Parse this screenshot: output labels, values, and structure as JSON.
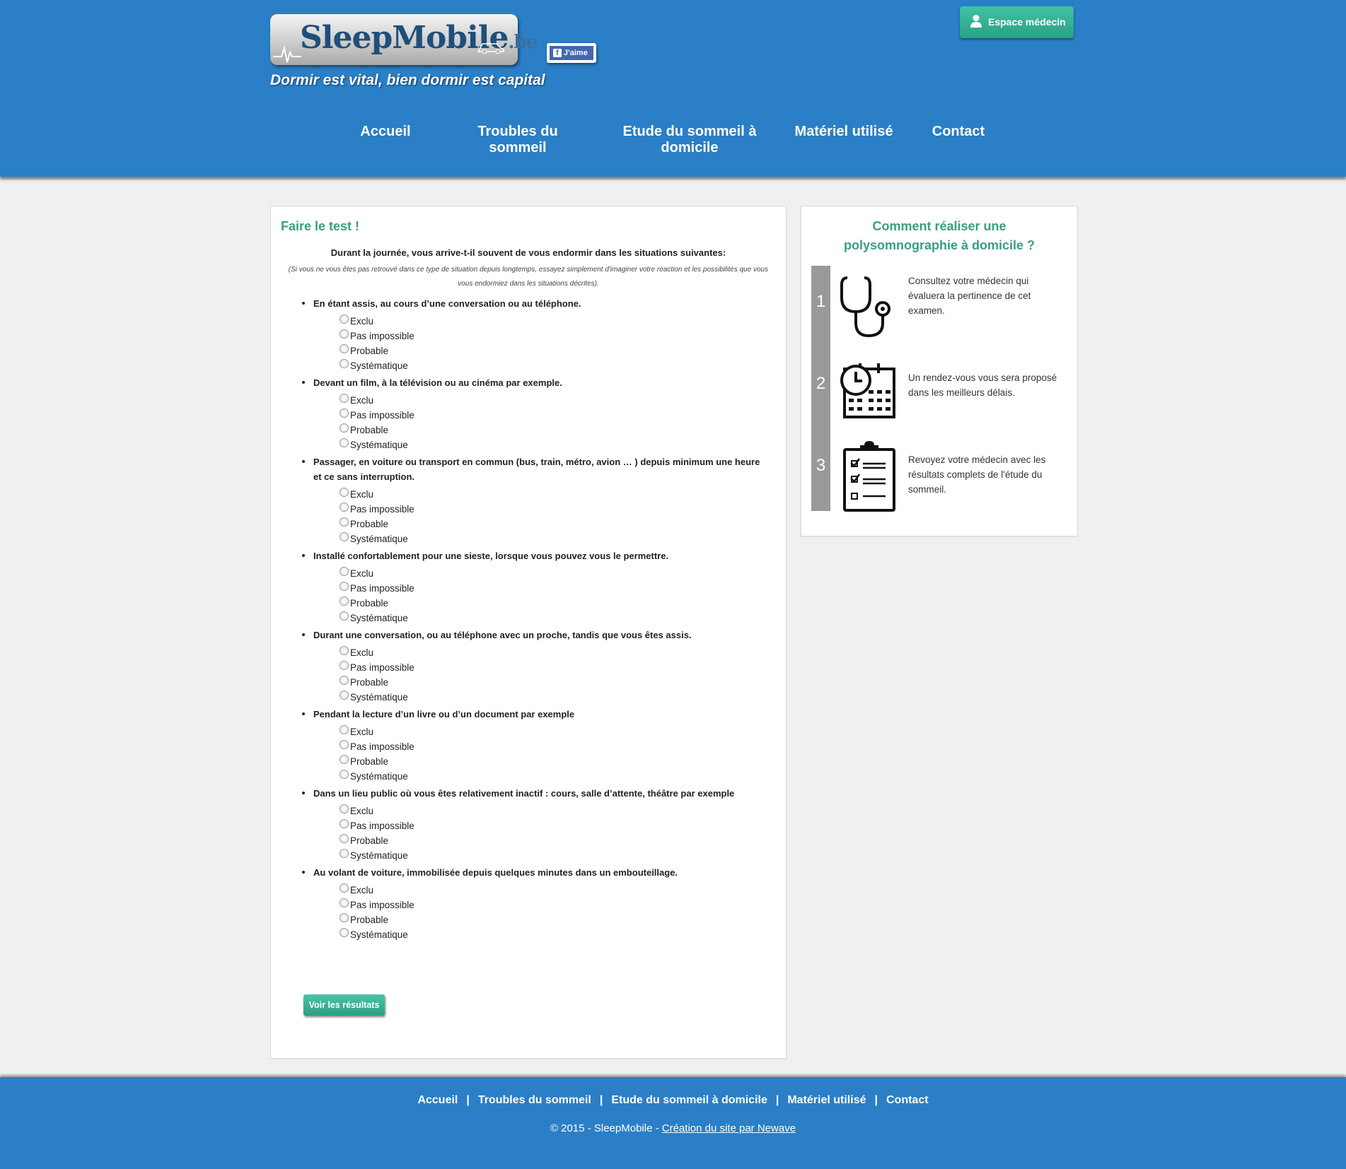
{
  "header": {
    "logo_text": "SleepMobile",
    "logo_tld": ".be",
    "facebook_like": "J'aime",
    "tagline": "Dormir est vital, bien dormir est capital",
    "doctor_button": "Espace médecin",
    "nav": {
      "home": "Accueil",
      "disorders": [
        "Troubles du",
        "sommeil"
      ],
      "study": [
        "Etude du sommeil à",
        "domicile"
      ],
      "equipment": "Matériel utilisé",
      "contact": "Contact"
    }
  },
  "test": {
    "title": "Faire le test !",
    "intro": "Durant la journée, vous arrive-t-il souvent de vous endormir dans les situations suivantes:",
    "note": "(Si vous ne vous êtes pas retrouvé dans ce type de situation depuis longtemps, essayez simplement d'imaginer votre réaction et les possibilités que vous vous endormiez dans les situations décrites).",
    "options": [
      "Exclu",
      "Pas impossible",
      "Probable",
      "Systématique"
    ],
    "questions": [
      "En étant assis, au cours d’une conversation ou au téléphone.",
      "Devant un film, à la télévision ou au cinéma par exemple.",
      "Passager, en voiture ou transport en commun (bus, train, métro, avion … ) depuis minimum une heure et ce sans interruption.",
      "Installé confortablement pour une sieste, lorsque vous pouvez vous le permettre.",
      "Durant une conversation, ou au téléphone avec un proche, tandis que vous êtes assis.",
      "Pendant la lecture d’un livre ou d’un document par exemple",
      "Dans un lieu public où vous êtes relativement inactif : cours, salle d’attente, théâtre par exemple",
      "Au volant de voiture, immobilisée depuis quelques minutes dans un embouteillage."
    ],
    "submit": "Voir les résultats"
  },
  "sidebar": {
    "title": [
      "Comment réaliser une",
      "polysomnographie à domicile ?"
    ],
    "steps": [
      {
        "num": "1",
        "icon": "stethoscope-icon",
        "text": "Consultez votre médecin qui évaluera la pertinence de cet examen."
      },
      {
        "num": "2",
        "icon": "calendar-clock-icon",
        "text": "Un rendez-vous vous sera proposé dans les meilleurs délais."
      },
      {
        "num": "3",
        "icon": "clipboard-checklist-icon",
        "text": "Revoyez votre médecin avec les résultats complets de l'étude du sommeil."
      }
    ]
  },
  "footer": {
    "links": [
      "Accueil",
      "Troubles du sommeil",
      "Etude du sommeil à domicile",
      "Matériel utilisé",
      "Contact"
    ],
    "separator": "|",
    "copyright": "© 2015 - SleepMobile - ",
    "credit": "Création du site par Newave"
  },
  "colors": {
    "header_blue": "#2a7fc6",
    "accent_green": "#3a9e83",
    "button_green": "#2aa184"
  }
}
